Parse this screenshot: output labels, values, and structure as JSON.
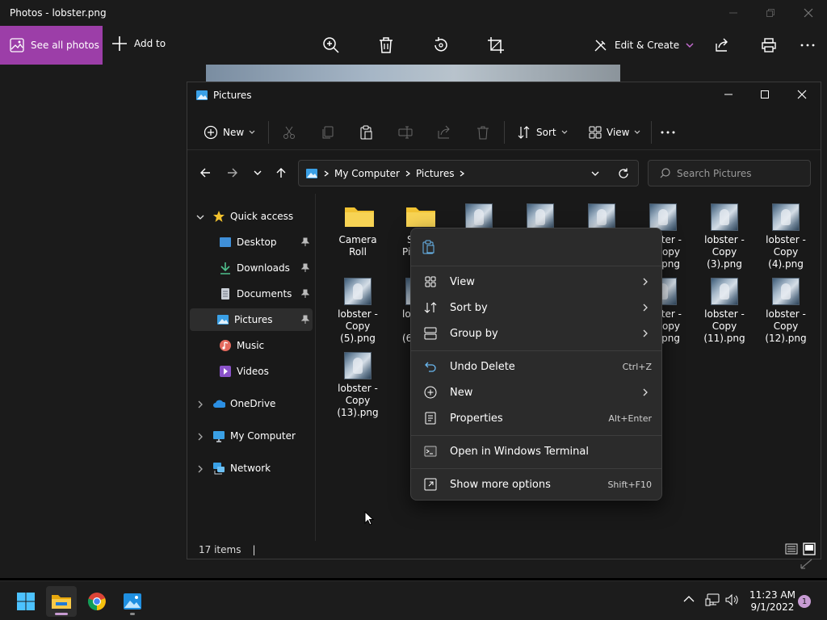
{
  "photos": {
    "title": "Photos - lobster.png",
    "see_all_label": "See all photos",
    "add_to_label": "Add to",
    "edit_create_label": "Edit & Create",
    "accent_color": "#9c3ea8"
  },
  "explorer": {
    "title": "Pictures",
    "cmd": {
      "new_label": "New",
      "sort_label": "Sort",
      "view_label": "View"
    },
    "address": {
      "crumbs": [
        "My Computer",
        "Pictures"
      ]
    },
    "search": {
      "placeholder": "Search Pictures"
    },
    "nav": {
      "quick_access": "Quick access",
      "desktop": "Desktop",
      "downloads": "Downloads",
      "documents": "Documents",
      "pictures": "Pictures",
      "music": "Music",
      "videos": "Videos",
      "onedrive": "OneDrive",
      "my_computer": "My Computer",
      "network": "Network"
    },
    "files": {
      "camera_roll": "Camera Roll",
      "saved_partial": "S",
      "saved_partial2": "Pi",
      "copy2_l1": "ster -",
      "copy2_l2": "opy",
      "copy2_l3": ".png",
      "copy3_l1": "lobster -",
      "copy3_l2": "Copy",
      "copy3_l3": "(3).png",
      "copy4_l1": "lobster -",
      "copy4_l2": "Copy",
      "copy4_l3": "(4).png",
      "copy5_l1": "lobster -",
      "copy5_l2": "Copy",
      "copy5_l3": "(5).png",
      "copy6_l1": "lo",
      "copy6_l2": "(6",
      "copy10_l1": "ster -",
      "copy10_l2": "opy",
      "copy10_l3": ".png",
      "copy11_l1": "lobster -",
      "copy11_l2": "Copy",
      "copy11_l3": "(11).png",
      "copy12_l1": "lobster -",
      "copy12_l2": "Copy",
      "copy12_l3": "(12).png",
      "copy13_l1": "lobster -",
      "copy13_l2": "Copy",
      "copy13_l3": "(13).png"
    },
    "status": {
      "count": "17 items",
      "sep": "|"
    }
  },
  "context_menu": {
    "view": "View",
    "sort_by": "Sort by",
    "group_by": "Group by",
    "undo_delete": "Undo Delete",
    "undo_shortcut": "Ctrl+Z",
    "new": "New",
    "properties": "Properties",
    "properties_shortcut": "Alt+Enter",
    "open_terminal": "Open in Windows Terminal",
    "show_more": "Show more options",
    "show_more_shortcut": "Shift+F10"
  },
  "taskbar": {
    "time": "11:23 AM",
    "date": "9/1/2022",
    "notification_count": "1"
  }
}
